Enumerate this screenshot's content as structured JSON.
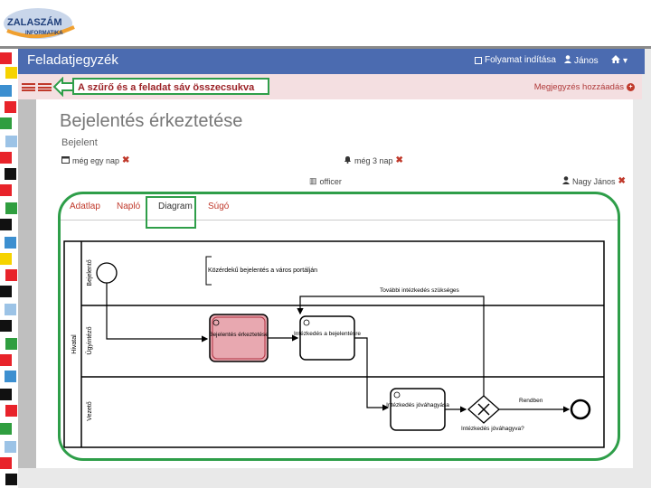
{
  "logo": {
    "line1": "ZALASZÁM",
    "line2": "INFORMATIKA"
  },
  "navbar": {
    "title": "Feladatjegyzék",
    "start_process": "Folyamat indítása",
    "user": "János",
    "home_caret": "▾"
  },
  "subbar": {
    "add_note": "Megjegyzés hozzáadás"
  },
  "callout": "A szűrő és a feladat sáv összecsukva",
  "task": {
    "title": "Bejelentés érkeztetése",
    "subtitle": "Bejelent",
    "due": "még egy nap",
    "reminder": "még 3 nap",
    "group": "officer",
    "assignee": "Nagy János"
  },
  "tabs": [
    "Adatlap",
    "Napló",
    "Diagram",
    "Súgó"
  ],
  "active_tab": "Diagram",
  "diagram": {
    "pool": "Hivatal",
    "lanes": [
      "Bejelentő",
      "Ügyintéző",
      "Vezető"
    ],
    "annotation": "Közérdekű bejelentés a város portálján",
    "tasks": [
      "Bejelentés érkeztetése",
      "Intézkedés a bejelentésre",
      "Intézkedés jóváhagyása"
    ],
    "flow_labels": [
      "További intézkedés szükséges",
      "Rendben",
      "Intézkedés jóváhagyva?"
    ]
  },
  "colors": {
    "navbar": "#4b6bb0",
    "accent_red": "#c0392b",
    "highlight_green": "#2e9e49",
    "active_task": "#e8a8b0"
  }
}
